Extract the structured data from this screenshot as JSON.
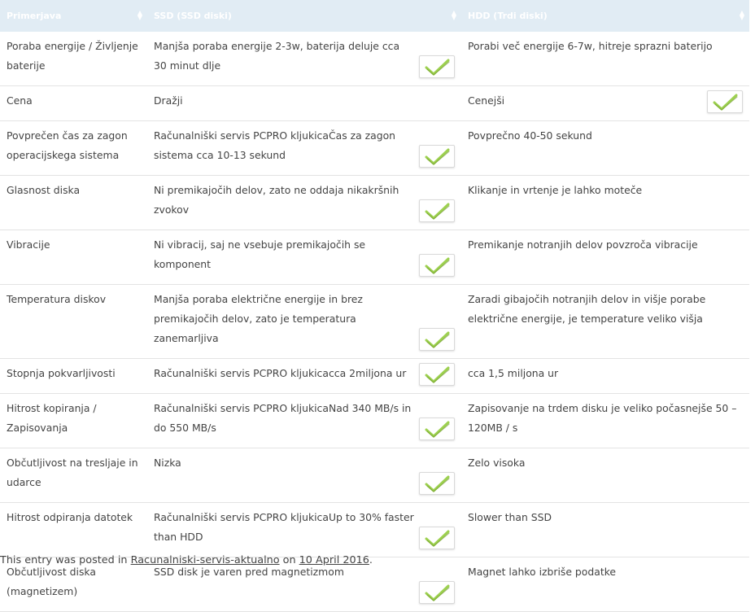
{
  "table": {
    "headers": [
      "Primerjava",
      "SSD (SSD diski)",
      "HDD (Trdi diski)"
    ],
    "rows": [
      {
        "label": "Poraba energije / Življenje baterije",
        "ssd": "Manjša poraba energije 2-3w, baterija deluje cca 30 minut dlje",
        "hdd": "Porabi več energije 6-7w, hitreje sprazni baterijo",
        "check": "ssd"
      },
      {
        "label": "Cena",
        "ssd": "Dražji",
        "hdd": "Cenejši",
        "check": "hdd"
      },
      {
        "label": "Povprečen čas za zagon operacijskega sistema",
        "ssd": "Računalniški servis PCPRO kljukicaČas za zagon sistema cca 10-13 sekund",
        "hdd": "Povprečno 40-50 sekund",
        "check": "ssd"
      },
      {
        "label": "Glasnost diska",
        "ssd": "Ni premikajočih delov, zato ne oddaja nikakršnih zvokov",
        "hdd": "Klikanje in vrtenje je lahko moteče",
        "check": "ssd"
      },
      {
        "label": "Vibracije",
        "ssd": "Ni vibracij, saj ne vsebuje premikajočih se komponent",
        "hdd": "Premikanje notranjih delov povzroča vibracije",
        "check": "ssd"
      },
      {
        "label": "Temperatura diskov",
        "ssd": "Manjša poraba električne energije in brez premikajočih delov, zato je temperatura zanemarljiva",
        "hdd": "Zaradi gibajočih notranjih delov in višje porabe električne energije, je temperature veliko višja",
        "check": "ssd"
      },
      {
        "label": "Stopnja pokvarljivosti",
        "ssd": "Računalniški servis PCPRO kljukicacca 2miljona ur",
        "hdd": "cca 1,5 miljona ur",
        "check": "ssd"
      },
      {
        "label": "Hitrost kopiranja / Zapisovanja",
        "ssd": "Računalniški servis PCPRO kljukicaNad 340 MB/s in do 550 MB/s",
        "hdd": "Zapisovanje na trdem disku je veliko počasnejše 50 – 120MB / s",
        "check": "ssd"
      },
      {
        "label": "Občutljivost na tresljaje in udarce",
        "ssd": "Nizka",
        "hdd": "Zelo visoka",
        "check": "ssd"
      },
      {
        "label": "Hitrost odpiranja datotek",
        "ssd": "Računalniški servis PCPRO kljukicaUp to 30% faster than HDD",
        "hdd": "Slower than SSD",
        "check": "ssd"
      },
      {
        "label": "Občutljivost diska (magnetizem)",
        "ssd": "SSD disk je varen pred magnetizmom",
        "hdd": "Magnet lahko izbriše podatke",
        "check": "ssd"
      }
    ]
  },
  "footer": {
    "prefix": "This entry was posted in ",
    "category": "Racunalniski-servis-aktualno",
    "middle": " on ",
    "date": "10 April 2016",
    "suffix": "."
  },
  "icons": {
    "sort": "sort-arrows-icon",
    "check": "checkmark-icon"
  },
  "colors": {
    "header_bg": "#e1ecf4",
    "check_green": "#8dc63f"
  }
}
